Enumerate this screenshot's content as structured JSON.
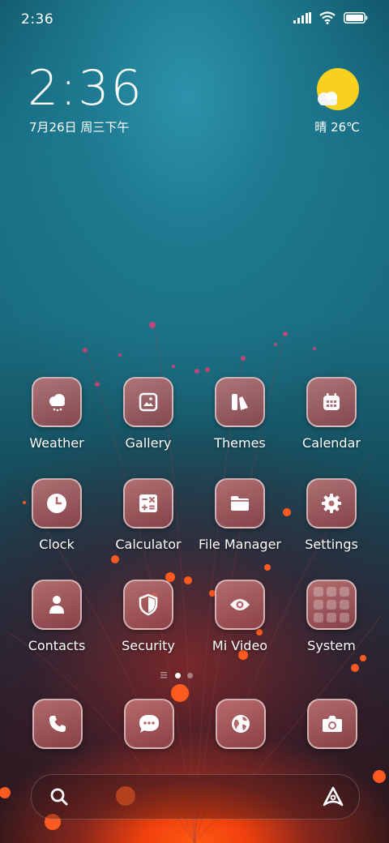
{
  "status_bar": {
    "time": "2:36",
    "signal_icon": "signal-icon",
    "wifi_icon": "wifi-icon",
    "battery_icon": "battery-icon"
  },
  "widget": {
    "time": "2:36",
    "date": "7月26日 周三下午",
    "weather": "晴 26℃",
    "weather_icon": "sun-cloud-icon"
  },
  "apps": [
    {
      "label": "Weather",
      "icon": "weather-icon"
    },
    {
      "label": "Gallery",
      "icon": "gallery-icon"
    },
    {
      "label": "Themes",
      "icon": "themes-icon"
    },
    {
      "label": "Calendar",
      "icon": "calendar-icon"
    },
    {
      "label": "Clock",
      "icon": "clock-icon"
    },
    {
      "label": "Calculator",
      "icon": "calculator-icon"
    },
    {
      "label": "File Manager",
      "icon": "folder-icon"
    },
    {
      "label": "Settings",
      "icon": "gear-icon"
    },
    {
      "label": "Contacts",
      "icon": "person-icon"
    },
    {
      "label": "Security",
      "icon": "shield-icon"
    },
    {
      "label": "Mi Video",
      "icon": "eye-icon"
    },
    {
      "label": "System",
      "icon": "folder-grid-icon"
    }
  ],
  "page_indicator": {
    "pages": 2,
    "current": 1
  },
  "dock": [
    {
      "icon": "phone-icon"
    },
    {
      "icon": "messages-icon"
    },
    {
      "icon": "globe-icon"
    },
    {
      "icon": "camera-icon"
    }
  ],
  "search": {
    "icon": "search-icon",
    "assistant_icon": "assistant-icon"
  },
  "colors": {
    "sun": "#f7d11e",
    "icon_tile": "#b36a6e",
    "accent_glow": "#ff5a12"
  }
}
